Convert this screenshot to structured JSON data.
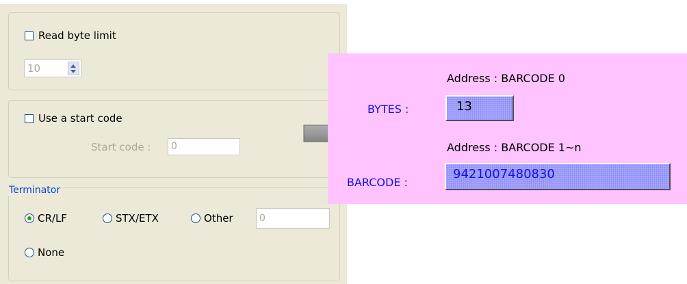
{
  "dialog": {
    "read_byte_limit": {
      "label": "Read byte limit",
      "checked": false,
      "value": "10"
    },
    "start_code": {
      "label": "Use a start code",
      "checked": false,
      "field_label": "Start code :",
      "value": "0"
    },
    "terminator": {
      "legend": "Terminator",
      "options": [
        {
          "label": "CR/LF",
          "selected": true
        },
        {
          "label": "STX/ETX",
          "selected": false
        },
        {
          "label": "Other",
          "selected": false
        },
        {
          "label": "None",
          "selected": false
        }
      ],
      "other_value": "0"
    }
  },
  "display": {
    "address0": "Address : BARCODE 0",
    "bytes_label": "BYTES :",
    "bytes_value": "13",
    "address1": "Address : BARCODE 1~n",
    "barcode_label": "BARCODE :",
    "barcode_value": "9421007480830"
  },
  "icons": {
    "arrow": "right-arrow-icon"
  },
  "colors": {
    "dialog_bg": "#ece9d8",
    "pink_bg": "#ffc3ff",
    "label_blue": "#1010e8",
    "radio_dot": "#21a121"
  }
}
